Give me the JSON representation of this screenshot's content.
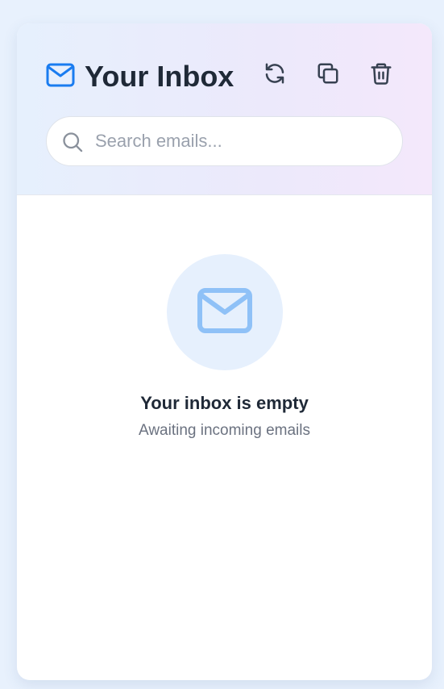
{
  "header": {
    "title": "Your Inbox",
    "icons": {
      "brand": "mail-icon",
      "refresh": "refresh-icon",
      "copy": "copy-icon",
      "delete": "trash-icon"
    }
  },
  "search": {
    "placeholder": "Search emails...",
    "value": ""
  },
  "empty_state": {
    "icon": "mail-icon",
    "title": "Your inbox is empty",
    "subtitle": "Awaiting incoming emails"
  },
  "colors": {
    "accent": "#1a7cf0",
    "empty_icon": "#8fc1f7",
    "icon_dark": "#374151",
    "background": "#e8f1fd"
  }
}
